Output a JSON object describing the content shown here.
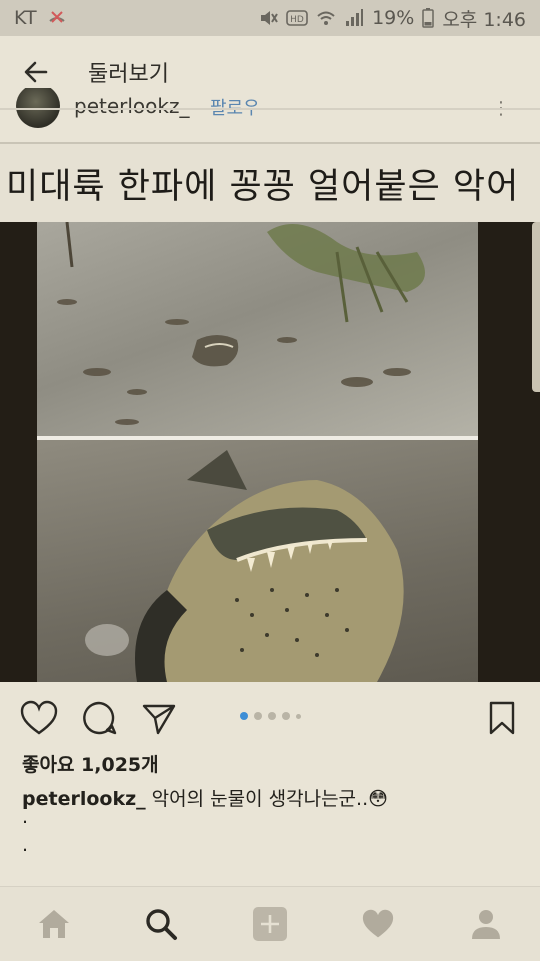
{
  "status_bar": {
    "carrier": "KT",
    "battery": "19%",
    "time": "오후 1:46"
  },
  "app_bar": {
    "title": "둘러보기"
  },
  "peek_row": {
    "username": "peterlookz_",
    "follow": "팔로우"
  },
  "post": {
    "title": "미대륙 한파에 꽁꽁 얼어붙은  악어",
    "carousel": {
      "total": 5,
      "current": 1
    },
    "likes": "좋아요 1,025개",
    "caption_user": "peterlookz_",
    "caption_text": " 악어의 눈물이 생각나는군..",
    "caption_emoji": "😳",
    "extra_lines": [
      ".",
      "."
    ]
  },
  "bottom_nav": {
    "items": [
      "home-icon",
      "search-icon",
      "add-icon",
      "heart-icon",
      "profile-icon"
    ],
    "active": "search-icon"
  },
  "colors": {
    "background": "#e9e4d6",
    "accent": "#3d8ed6",
    "text": "#23211c"
  }
}
